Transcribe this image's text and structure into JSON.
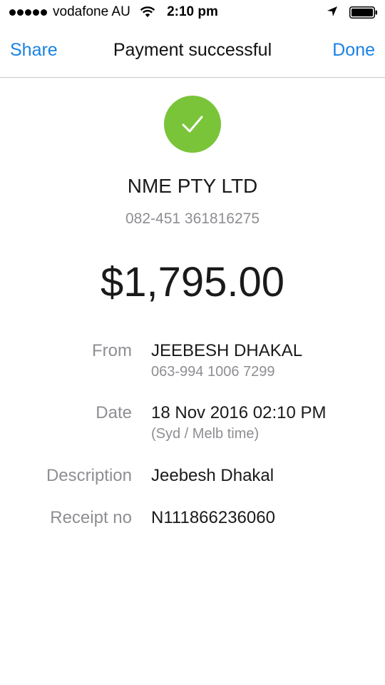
{
  "status_bar": {
    "carrier": "vodafone AU",
    "time": "2:10 pm",
    "icons": [
      "signal-dots-icon",
      "wifi-icon",
      "location-arrow-icon",
      "battery-icon"
    ]
  },
  "nav": {
    "left_label": "Share",
    "title": "Payment successful",
    "right_label": "Done",
    "accent_color": "#1a82e2"
  },
  "success": {
    "icon": "checkmark-icon",
    "color": "#7ac43a"
  },
  "payee": {
    "name": "NME PTY LTD",
    "account": "082-451 361816275"
  },
  "amount": "$1,795.00",
  "details": {
    "from": {
      "label": "From",
      "name": "JEEBESH DHAKAL",
      "account": "063-994 1006 7299"
    },
    "date": {
      "label": "Date",
      "value": "18 Nov 2016 02:10 PM",
      "note": "(Syd / Melb time)"
    },
    "description": {
      "label": "Description",
      "value": "Jeebesh Dhakal"
    },
    "receipt": {
      "label": "Receipt no",
      "value": "N111866236060"
    }
  }
}
